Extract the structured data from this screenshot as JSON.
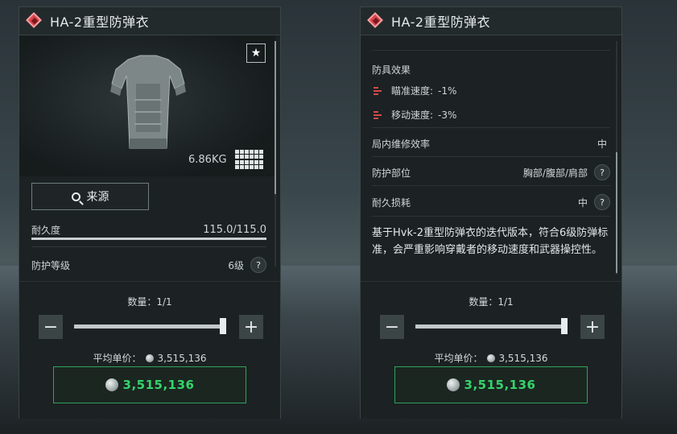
{
  "left_panel": {
    "title": "HA-2重型防弹衣",
    "weight": "6.86KG",
    "source_button": "来源",
    "durability": {
      "label": "耐久度",
      "value": "115.0/115.0",
      "fraction": 1.0
    },
    "protection_level": {
      "label": "防护等级",
      "value": "6级",
      "help": "?"
    },
    "favorite_icon": "star-icon",
    "size_icon": "grid-icon"
  },
  "right_panel": {
    "title": "HA-2重型防弹衣",
    "effects_title": "防具效果",
    "effects": [
      {
        "label": "瞄准速度:",
        "value": "-1%",
        "icon": "debuff-icon"
      },
      {
        "label": "移动速度:",
        "value": "-3%",
        "icon": "debuff-icon"
      }
    ],
    "repair_efficiency": {
      "label": "局内维修效率",
      "value": "中"
    },
    "protected_parts": {
      "label": "防护部位",
      "value": "胸部/腹部/肩部",
      "help": "?"
    },
    "durability_loss": {
      "label": "耐久损耗",
      "value": "中",
      "help": "?"
    },
    "description": "基于Hvk-2重型防弹衣的迭代版本，符合6级防弹标准，会严重影响穿戴者的移动速度和武器操控性。"
  },
  "purchase": {
    "quantity_label": "数量：1/1",
    "minus": "−",
    "plus": "+",
    "slider_fraction": 1.0,
    "avg_price_label": "平均单价：",
    "avg_price": "3,515,136",
    "total_price": "3,515,136",
    "price_color": "#35d46b"
  }
}
